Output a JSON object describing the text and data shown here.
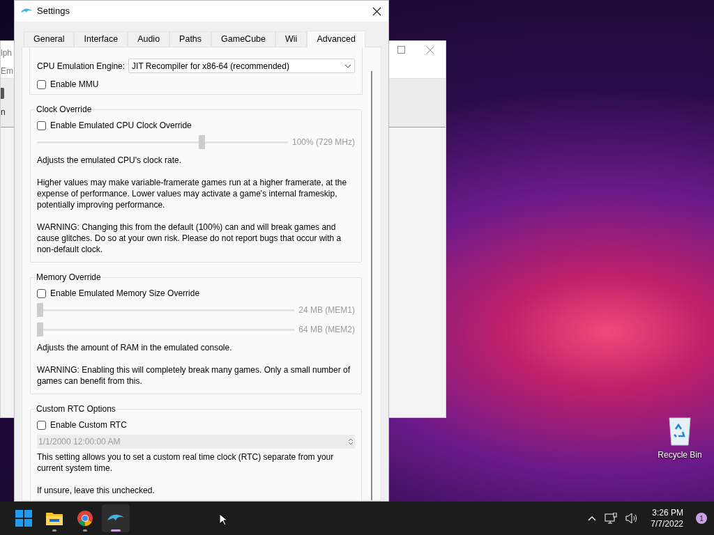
{
  "background_window": {
    "texts": [
      "lph",
      "Em",
      "n"
    ]
  },
  "settings": {
    "title": "Settings",
    "tabs": [
      {
        "label": "General",
        "selected": false
      },
      {
        "label": "Interface",
        "selected": false
      },
      {
        "label": "Audio",
        "selected": false
      },
      {
        "label": "Paths",
        "selected": false
      },
      {
        "label": "GameCube",
        "selected": false
      },
      {
        "label": "Wii",
        "selected": false
      },
      {
        "label": "Advanced",
        "selected": true
      }
    ],
    "cpu_options": {
      "engine_label": "CPU Emulation Engine:",
      "engine_value": "JIT Recompiler for x86-64 (recommended)",
      "mmu": {
        "label": "Enable MMU",
        "checked": false
      }
    },
    "clock_override": {
      "title": "Clock Override",
      "checkbox": {
        "label": "Enable Emulated CPU Clock Override",
        "checked": false
      },
      "sliders": [
        {
          "level": 0.66,
          "reading": "100% (729 MHz)",
          "disabled": true
        }
      ],
      "paragraphs": [
        "Adjusts the emulated CPU's clock rate.",
        "Higher values may make variable-framerate games run at a higher framerate, at the expense of performance. Lower values may activate a game's internal frameskip, potentially improving performance.",
        "WARNING: Changing this from the default (100%) can and will break games and cause glitches. Do so at your own risk. Please do not report bugs that occur with a non-default clock."
      ]
    },
    "memory_override": {
      "title": "Memory Override",
      "checkbox": {
        "label": "Enable Emulated Memory Size Override",
        "checked": false
      },
      "sliders": [
        {
          "level": 0,
          "reading": "24 MB (MEM1)",
          "disabled": true
        },
        {
          "level": 0,
          "reading": "64 MB (MEM2)",
          "disabled": true
        }
      ],
      "paragraphs": [
        "Adjusts the amount of RAM in the emulated console.",
        "WARNING: Enabling this will completely break many games. Only a small number of games can benefit from this."
      ]
    },
    "custom_rtc": {
      "title": "Custom RTC Options",
      "checkbox": {
        "label": "Enable Custom RTC",
        "checked": false
      },
      "datetime": {
        "value": "1/1/2000 12:00:00 AM",
        "disabled": true
      },
      "paragraphs": [
        "This setting allows you to set a custom real time clock (RTC) separate from your current system time.",
        "If unsure, leave this unchecked."
      ]
    }
  },
  "desktop": {
    "recycle_bin": "Recycle Bin"
  },
  "taskbar": {
    "apps": [
      {
        "kind": "start",
        "selected": false
      },
      {
        "kind": "explorer",
        "selected": false
      },
      {
        "kind": "browser",
        "selected": false
      },
      {
        "kind": "dolphin",
        "selected": true
      }
    ],
    "time": "3:26 PM",
    "date": "7/7/2022",
    "notifications": "1"
  }
}
